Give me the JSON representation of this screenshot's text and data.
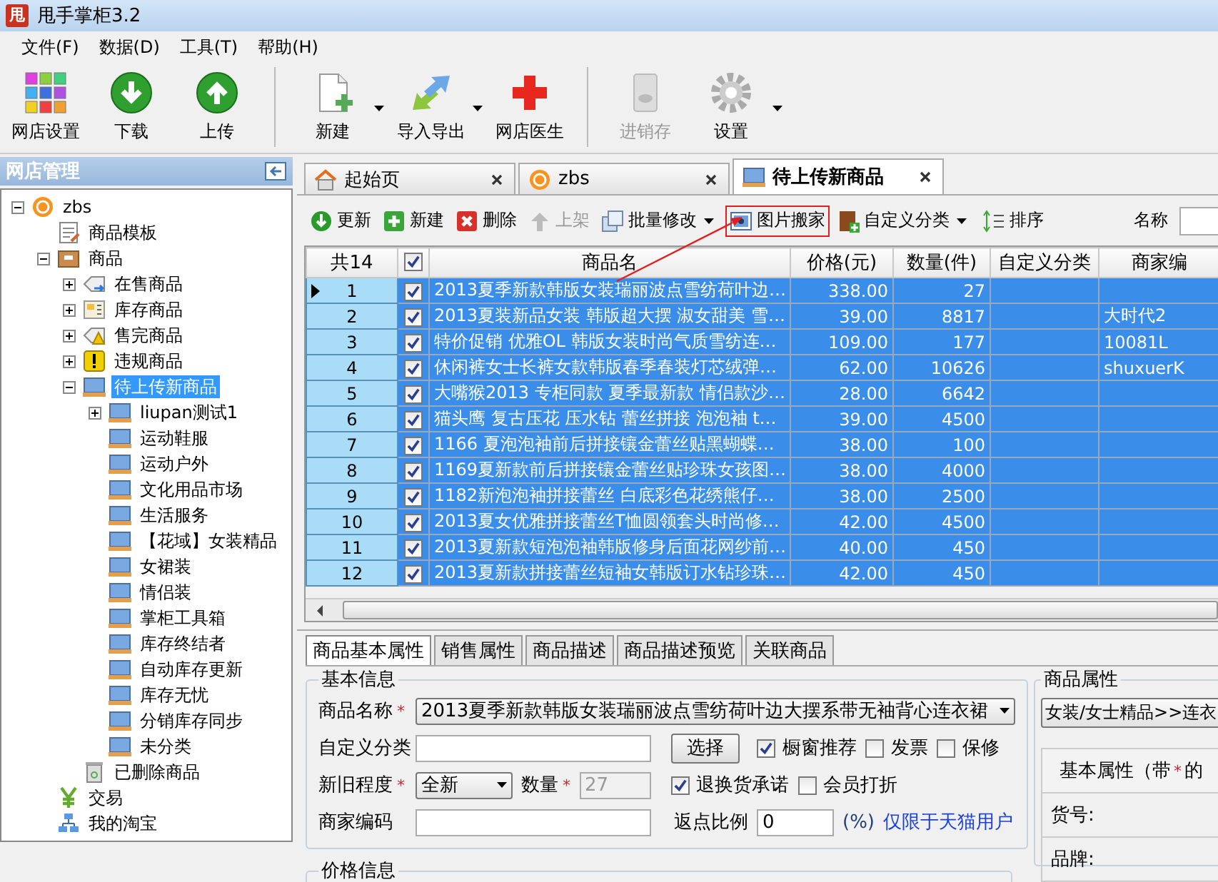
{
  "window": {
    "icon_text": "甩",
    "title": "甩手掌柜3.2"
  },
  "menu": [
    "文件(F)",
    "数据(D)",
    "工具(T)",
    "帮助(H)"
  ],
  "toolbar": {
    "groups": [
      [
        {
          "label": "网店设置",
          "kind": "grid",
          "dropdown": false,
          "disabled": false
        },
        {
          "label": "下载",
          "kind": "download",
          "dropdown": false,
          "disabled": false
        },
        {
          "label": "上传",
          "kind": "upload",
          "dropdown": false,
          "disabled": false
        }
      ],
      [
        {
          "label": "新建",
          "kind": "newdoc",
          "dropdown": true,
          "disabled": false
        },
        {
          "label": "导入导出",
          "kind": "importexport",
          "dropdown": true,
          "disabled": false
        },
        {
          "label": "网店医生",
          "kind": "doctor",
          "dropdown": false,
          "disabled": false
        }
      ],
      [
        {
          "label": "进销存",
          "kind": "inventory",
          "dropdown": false,
          "disabled": true
        },
        {
          "label": "设置",
          "kind": "gear",
          "dropdown": true,
          "disabled": false
        }
      ]
    ]
  },
  "sidebar": {
    "title": "网店管理",
    "tree": [
      {
        "label": "zbs",
        "kind": "shop",
        "expanded": true,
        "selected": false,
        "children": [
          {
            "label": "商品模板",
            "kind": "template",
            "selected": false
          },
          {
            "label": "商品",
            "kind": "box",
            "expanded": true,
            "selected": false,
            "children": [
              {
                "label": "在售商品",
                "kind": "tag",
                "expanded": false,
                "selected": false
              },
              {
                "label": "库存商品",
                "kind": "folderlist",
                "expanded": false,
                "selected": false
              },
              {
                "label": "售完商品",
                "kind": "tagwarn",
                "expanded": false,
                "selected": false
              },
              {
                "label": "违规商品",
                "kind": "warn",
                "expanded": false,
                "selected": false
              },
              {
                "label": "待上传新商品",
                "kind": "screen",
                "expanded": true,
                "selected": true,
                "children": [
                  {
                    "label": "liupan测试1",
                    "kind": "screen",
                    "expanded": false,
                    "selected": false
                  },
                  {
                    "label": "运动鞋服",
                    "kind": "screen",
                    "selected": false
                  },
                  {
                    "label": "运动户外",
                    "kind": "screen",
                    "selected": false
                  },
                  {
                    "label": "文化用品市场",
                    "kind": "screen",
                    "selected": false
                  },
                  {
                    "label": "生活服务",
                    "kind": "screen",
                    "selected": false
                  },
                  {
                    "label": "【花域】女装精品",
                    "kind": "screen",
                    "selected": false
                  },
                  {
                    "label": "女裙装",
                    "kind": "screen",
                    "selected": false
                  },
                  {
                    "label": "情侣装",
                    "kind": "screen",
                    "selected": false
                  },
                  {
                    "label": "掌柜工具箱",
                    "kind": "screen",
                    "selected": false
                  },
                  {
                    "label": "库存终结者",
                    "kind": "screen",
                    "selected": false
                  },
                  {
                    "label": "自动库存更新",
                    "kind": "screen",
                    "selected": false
                  },
                  {
                    "label": "库存无忧",
                    "kind": "screen",
                    "selected": false
                  },
                  {
                    "label": "分销库存同步",
                    "kind": "screen",
                    "selected": false
                  },
                  {
                    "label": "未分类",
                    "kind": "screen",
                    "selected": false
                  }
                ]
              },
              {
                "label": "已删除商品",
                "kind": "trash",
                "selected": false
              }
            ]
          },
          {
            "label": "交易",
            "kind": "yen",
            "selected": false
          },
          {
            "label": "我的淘宝",
            "kind": "network",
            "selected": false
          }
        ]
      }
    ]
  },
  "tabs": [
    {
      "label": "起始页",
      "kind": "home",
      "selected": false
    },
    {
      "label": "zbs",
      "kind": "shop",
      "selected": false
    },
    {
      "label": "待上传新商品",
      "kind": "screen",
      "selected": true
    }
  ],
  "actions": [
    {
      "label": "更新",
      "kind": "refresh",
      "disabled": false,
      "dropdown": false,
      "highlighted": false
    },
    {
      "label": "新建",
      "kind": "add",
      "disabled": false,
      "dropdown": false,
      "highlighted": false
    },
    {
      "label": "删除",
      "kind": "delete",
      "disabled": false,
      "dropdown": false,
      "highlighted": false
    },
    {
      "label": "上架",
      "kind": "up",
      "disabled": true,
      "dropdown": false,
      "highlighted": false
    },
    {
      "label": "批量修改",
      "kind": "batch",
      "disabled": false,
      "dropdown": true,
      "highlighted": false
    },
    {
      "label": "图片搬家",
      "kind": "picture",
      "disabled": false,
      "dropdown": false,
      "highlighted": true
    },
    {
      "label": "自定义分类",
      "kind": "category",
      "disabled": false,
      "dropdown": true,
      "highlighted": false
    },
    {
      "label": "排序",
      "kind": "sort",
      "disabled": false,
      "dropdown": false,
      "highlighted": false
    }
  ],
  "filter": {
    "label": "名称"
  },
  "table": {
    "count": "共14",
    "all_checked": true,
    "columns": [
      "商品名",
      "价格(元)",
      "数量(件)",
      "自定义分类",
      "商家编"
    ],
    "rows": [
      {
        "number": "1",
        "current": true,
        "checked": true,
        "selected": true,
        "name": "2013夏季新款韩版女装瑞丽波点雪纺荷叶边…",
        "price": "338.00",
        "quantity": "27"
      },
      {
        "number": "2",
        "current": false,
        "checked": true,
        "selected": true,
        "name": "2013夏装新品女装 韩版超大摆 淑女甜美 雪…",
        "price": "39.00",
        "quantity": "8817",
        "code": "大时代2"
      },
      {
        "number": "3",
        "current": false,
        "checked": true,
        "selected": true,
        "name": "特价促销 优雅OL 韩版女装时尚气质雪纺连…",
        "price": "109.00",
        "quantity": "177",
        "code": "10081L"
      },
      {
        "number": "4",
        "current": false,
        "checked": true,
        "selected": true,
        "name": "休闲裤女士长裤女款韩版春季春装灯芯绒弹…",
        "price": "62.00",
        "quantity": "10626",
        "code": "shuxuerK"
      },
      {
        "number": "5",
        "current": false,
        "checked": true,
        "selected": true,
        "name": "大嘴猴2013 专柜同款 夏季最新款 情侣款沙…",
        "price": "28.00",
        "quantity": "6642"
      },
      {
        "number": "6",
        "current": false,
        "checked": true,
        "selected": true,
        "name": "猫头鹰 复古压花 压水钻 蕾丝拼接 泡泡袖 t…",
        "price": "39.00",
        "quantity": "4500"
      },
      {
        "number": "7",
        "current": false,
        "checked": true,
        "selected": true,
        "name": "1166 夏泡泡袖前后拼接镶金蕾丝贴黑蝴蝶…",
        "price": "38.00",
        "quantity": "100"
      },
      {
        "number": "8",
        "current": false,
        "checked": true,
        "selected": true,
        "name": "1169夏新款前后拼接镶金蕾丝贴珍珠女孩图…",
        "price": "38.00",
        "quantity": "4000"
      },
      {
        "number": "9",
        "current": false,
        "checked": true,
        "selected": true,
        "name": "1182新泡泡袖拼接蕾丝 白底彩色花绣熊仔…",
        "price": "38.00",
        "quantity": "2500"
      },
      {
        "number": "10",
        "current": false,
        "checked": true,
        "selected": true,
        "name": "2013夏女优雅拼接蕾丝T恤圆领套头时尚修…",
        "price": "42.00",
        "quantity": "4500"
      },
      {
        "number": "11",
        "current": false,
        "checked": true,
        "selected": true,
        "name": "2013夏新款短泡泡袖韩版修身后面花网纱前…",
        "price": "40.00",
        "quantity": "450"
      },
      {
        "number": "12",
        "current": false,
        "checked": true,
        "selected": true,
        "name": "2013夏新款拼接蕾丝短袖女韩版订水钻珍珠…",
        "price": "42.00",
        "quantity": "450"
      }
    ]
  },
  "detail": {
    "tabs": [
      {
        "label": "商品基本属性",
        "selected": true
      },
      {
        "label": "销售属性",
        "selected": false
      },
      {
        "label": "商品描述",
        "selected": false
      },
      {
        "label": "商品描述预览",
        "selected": false
      },
      {
        "label": "关联商品",
        "selected": false
      }
    ],
    "basic": {
      "title": "基本信息",
      "rows": [
        {
          "fields": [
            {
              "kind": "label",
              "text": "商品名称",
              "mark": "*"
            },
            {
              "kind": "select",
              "value": "2013夏季新款韩版女装瑞丽波点雪纺荷叶边大摆系带无袖背心连衣裙"
            }
          ]
        },
        {
          "fields": [
            {
              "kind": "label",
              "text": "自定义分类"
            },
            {
              "kind": "input",
              "disabled": false
            },
            {
              "kind": "button",
              "label": "选择"
            },
            {
              "kind": "checkbox",
              "label": "橱窗推荐",
              "checked": true
            },
            {
              "kind": "checkbox",
              "label": "发票",
              "checked": false
            },
            {
              "kind": "checkbox",
              "label": "保修",
              "checked": false
            }
          ]
        },
        {
          "fields": [
            {
              "kind": "label",
              "text": "新旧程度",
              "mark": "*"
            },
            {
              "kind": "select",
              "value": "全新"
            },
            {
              "kind": "label",
              "text": "数量",
              "mark": "*"
            },
            {
              "kind": "input",
              "value": "27",
              "disabled": true
            },
            {
              "kind": "checkbox",
              "label": "退换货承诺",
              "checked": true
            },
            {
              "kind": "checkbox",
              "label": "会员打折",
              "checked": false
            }
          ]
        },
        {
          "fields": [
            {
              "kind": "label",
              "text": "商家编码"
            },
            {
              "kind": "input",
              "disabled": false
            },
            {
              "kind": "label",
              "text": "返点比例"
            },
            {
              "kind": "input",
              "value": "0",
              "disabled": false
            },
            {
              "kind": "text",
              "text": "(%)"
            },
            {
              "kind": "link",
              "text": "仅限于天猫用户"
            }
          ]
        }
      ]
    },
    "price": {
      "title": "价格信息"
    },
    "properties": {
      "title": "商品属性",
      "category": "女装/女士精品>>连衣",
      "header": "基本属性（带",
      "mark": "*",
      "header_rest": "的",
      "rows": [
        "货号:",
        "品牌:"
      ]
    }
  },
  "annotations": [
    {
      "kind": "arrow"
    }
  ]
}
